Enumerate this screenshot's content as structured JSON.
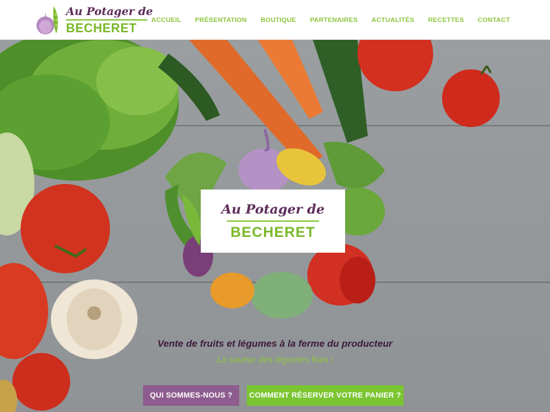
{
  "header": {
    "logo": {
      "script_text": "Au Potager de",
      "bold_text": "BECHERET"
    },
    "nav": [
      {
        "label": "ACCUEIL"
      },
      {
        "label": "PRÉSENTATION"
      },
      {
        "label": "BOUTIQUE"
      },
      {
        "label": "PARTENAIRES"
      },
      {
        "label": "ACTUALITÉS"
      },
      {
        "label": "RECETTES"
      },
      {
        "label": "CONTACT"
      }
    ]
  },
  "hero": {
    "card": {
      "script_text": "Au Potager de",
      "bold_text": "BECHERET"
    },
    "tagline": "Vente de fruits et légumes à la ferme du producteur",
    "subtagline": "La saveur des légumes frais !",
    "buttons": {
      "about": "QUI SOMMES-NOUS ?",
      "reserve": "COMMENT RÉSERVER VOTRE PANIER ?"
    }
  },
  "colors": {
    "brand_green": "#8cc63f",
    "brand_purple": "#5e2d5b",
    "button_purple": "#8e5c8f",
    "button_green": "#7ac531"
  }
}
